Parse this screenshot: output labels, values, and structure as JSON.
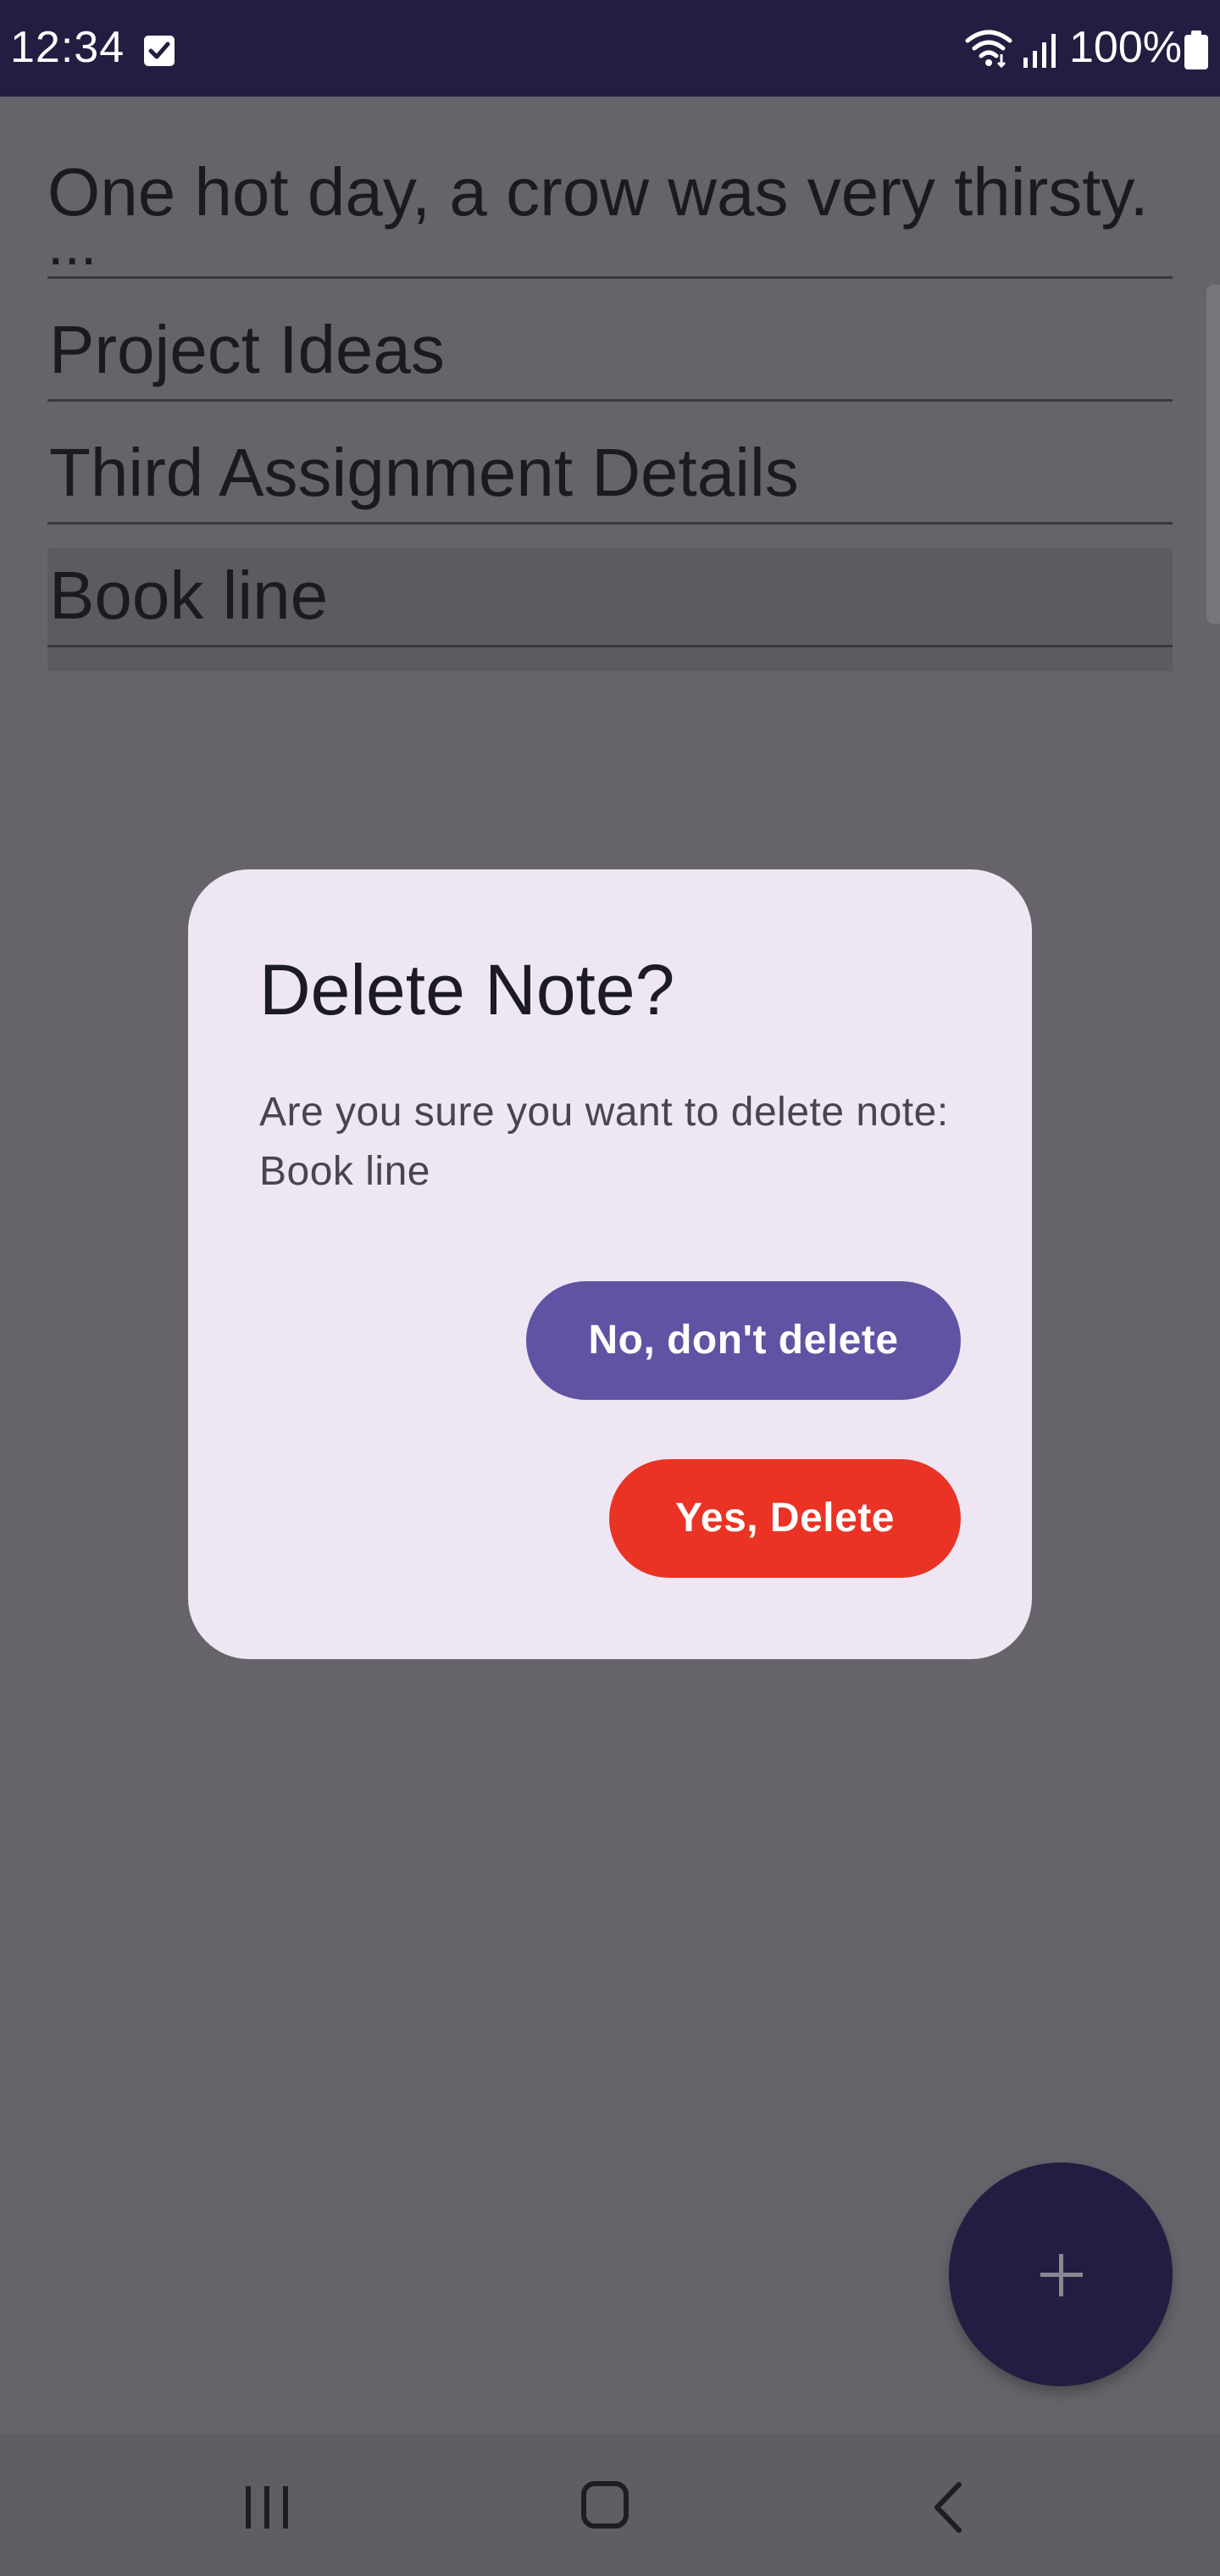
{
  "status_bar": {
    "time": "12:34",
    "battery": "100%",
    "icons": [
      "checkbox-notification-icon",
      "wifi-icon",
      "signal-icon",
      "battery-icon"
    ]
  },
  "notes": [
    {
      "title": "One hot day, a crow was very thirsty.",
      "ellipsis": "..."
    },
    {
      "title": "Project Ideas"
    },
    {
      "title": "Third Assignment Details"
    },
    {
      "title": "Book line",
      "selected": true
    }
  ],
  "dialog": {
    "title": "Delete Note?",
    "message": "Are you sure you want to delete note:\nBook line",
    "cancel_label": "No, don't delete",
    "confirm_label": "Yes, Delete"
  },
  "fab": {
    "icon": "plus-icon"
  },
  "nav_bar": {
    "icons": [
      "recent-apps-icon",
      "home-icon",
      "back-icon"
    ]
  },
  "colors": {
    "status_bar": "#241d41",
    "scrim_background": "#66646a",
    "dialog_background": "#eee7f3",
    "cancel_button": "#6153a3",
    "delete_button": "#ea3324",
    "fab": "#241d41"
  }
}
